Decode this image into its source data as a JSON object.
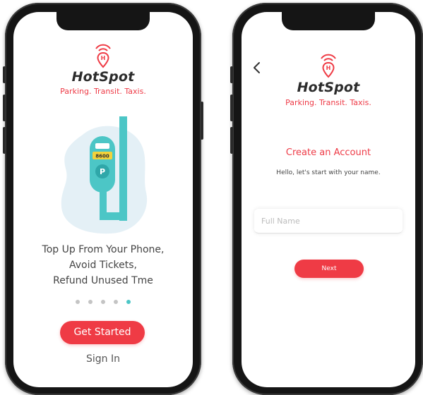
{
  "brand": {
    "name": "HotSpot",
    "tagline": "Parking. Transit. Taxis.",
    "accent_color": "#ef3b45",
    "icon": "location-signal-icon"
  },
  "onboarding": {
    "illustration": {
      "icon": "parking-meter-icon",
      "meter_label": "8600",
      "meter_symbol": "P"
    },
    "tagline_lines": [
      "Top Up From Your Phone,",
      "Avoid Tickets,",
      "Refund Unused Tme"
    ],
    "page_count": 5,
    "active_page": 5,
    "get_started_label": "Get Started",
    "sign_in_label": "Sign In",
    "active_dot_color": "#4cc6c6"
  },
  "create_account": {
    "back_icon": "chevron-left-icon",
    "heading": "Create an Account",
    "subheading": "Hello, let's start with your name.",
    "full_name_placeholder": "Full Name",
    "full_name_value": "",
    "next_label": "Next"
  }
}
